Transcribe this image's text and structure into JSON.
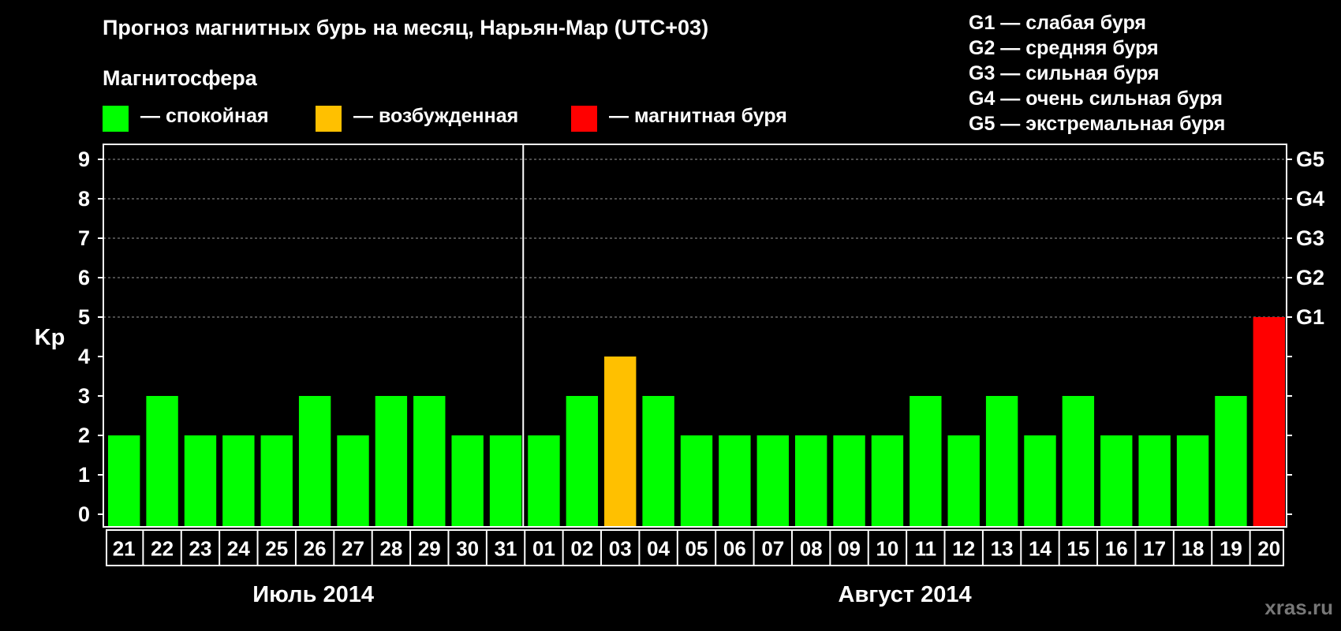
{
  "title": "Прогноз магнитных бурь на месяц, Нарьян-Мар (UTC+03)",
  "legend": {
    "heading": "Магнитосфера",
    "items": [
      {
        "label": "— спокойная",
        "color": "#00ff00"
      },
      {
        "label": "— возбужденная",
        "color": "#ffc000"
      },
      {
        "label": "— магнитная буря",
        "color": "#ff0000"
      }
    ]
  },
  "g_scale": [
    "G1 — слабая буря",
    "G2 — средняя буря",
    "G3 — сильная буря",
    "G4 — очень сильная буря",
    "G5 — экстремальная буря"
  ],
  "watermark": "xras.ru",
  "chart_data": {
    "type": "bar",
    "ylabel": "Kp",
    "ylim": [
      0,
      9
    ],
    "yticks": [
      "0",
      "1",
      "2",
      "3",
      "4",
      "5",
      "6",
      "7",
      "8",
      "9"
    ],
    "grid": "dashed horizontal lines at 5–9",
    "right_axis_labels": [
      {
        "kp": 5,
        "label": "G1"
      },
      {
        "kp": 6,
        "label": "G2"
      },
      {
        "kp": 7,
        "label": "G3"
      },
      {
        "kp": 8,
        "label": "G4"
      },
      {
        "kp": 9,
        "label": "G5"
      }
    ],
    "categories": [
      "21",
      "22",
      "23",
      "24",
      "25",
      "26",
      "27",
      "28",
      "29",
      "30",
      "31",
      "01",
      "02",
      "03",
      "04",
      "05",
      "06",
      "07",
      "08",
      "09",
      "10",
      "11",
      "12",
      "13",
      "14",
      "15",
      "16",
      "17",
      "18",
      "19",
      "20"
    ],
    "values": [
      2,
      3,
      2,
      2,
      2,
      3,
      2,
      3,
      3,
      2,
      2,
      2,
      3,
      4,
      3,
      2,
      2,
      2,
      2,
      2,
      2,
      3,
      2,
      3,
      2,
      3,
      2,
      2,
      2,
      3,
      5
    ],
    "colors": [
      "#00ff00",
      "#00ff00",
      "#00ff00",
      "#00ff00",
      "#00ff00",
      "#00ff00",
      "#00ff00",
      "#00ff00",
      "#00ff00",
      "#00ff00",
      "#00ff00",
      "#00ff00",
      "#00ff00",
      "#ffc000",
      "#00ff00",
      "#00ff00",
      "#00ff00",
      "#00ff00",
      "#00ff00",
      "#00ff00",
      "#00ff00",
      "#00ff00",
      "#00ff00",
      "#00ff00",
      "#00ff00",
      "#00ff00",
      "#00ff00",
      "#00ff00",
      "#00ff00",
      "#00ff00",
      "#ff0000"
    ],
    "months": [
      {
        "label": "Июль 2014",
        "days": 11
      },
      {
        "label": "Август 2014",
        "days": 20
      }
    ]
  }
}
